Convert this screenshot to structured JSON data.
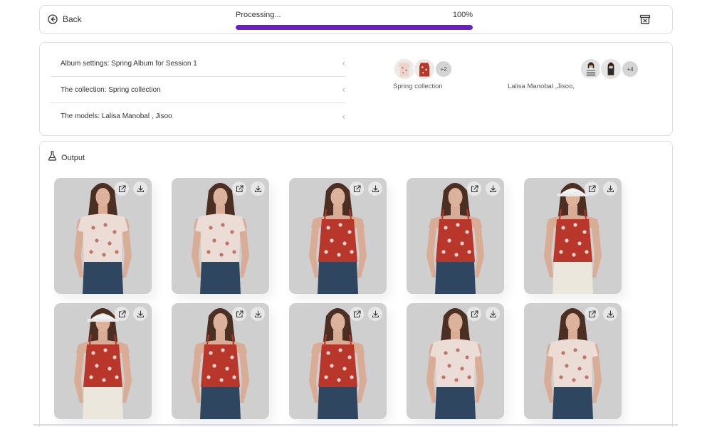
{
  "topbar": {
    "back_label": "Back",
    "progress_status": "Processing...",
    "progress_percent_label": "100%",
    "progress_value": 100,
    "progress_color": "#6a1fc7"
  },
  "settings": {
    "rows": [
      {
        "label": "Album settings: Spring Album for Session 1"
      },
      {
        "label": "The collection: Spring collection"
      },
      {
        "label": "The models: Lalisa Manobal , Jisoo"
      }
    ],
    "collection": {
      "more_label": "+2",
      "caption": "Spring collection"
    },
    "models": {
      "more_label": "+4",
      "caption": "Lalisa Manobal ,Jisoo,"
    }
  },
  "output": {
    "title": "Output",
    "cards": [
      {
        "garment": "white-floral-tee"
      },
      {
        "garment": "white-floral-tee"
      },
      {
        "garment": "red-floral-cami"
      },
      {
        "garment": "red-floral-cami"
      },
      {
        "garment": "red-floral-cami-bucket-hat"
      },
      {
        "garment": "red-floral-cami-bucket-hat"
      },
      {
        "garment": "red-floral-cami"
      },
      {
        "garment": "red-floral-cami"
      },
      {
        "garment": "white-floral-tee"
      },
      {
        "garment": "white-floral-tee"
      }
    ]
  },
  "icons": {
    "back": "arrow-left-circle-icon",
    "archive": "archive-box-icon",
    "output": "flask-icon",
    "open": "external-link-icon",
    "download": "download-icon"
  },
  "colors": {
    "accent": "#6a1fc7",
    "card_background": "#cfcfcf",
    "red_top": "#b8362a",
    "white_top": "#ecdcd6"
  }
}
